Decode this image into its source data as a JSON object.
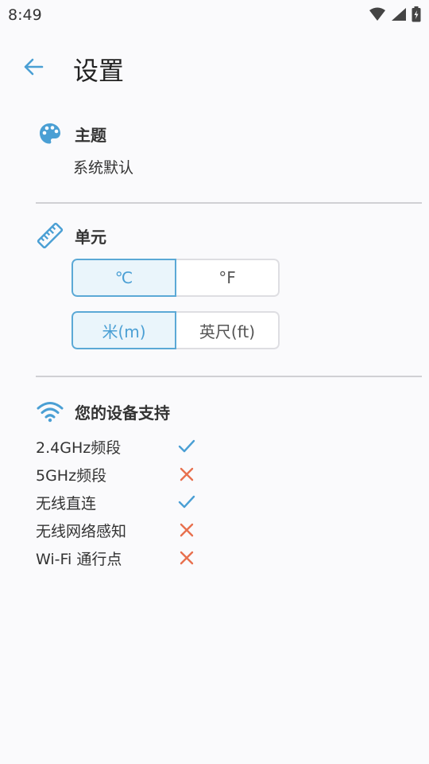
{
  "status_bar": {
    "time": "8:49"
  },
  "header": {
    "title": "设置",
    "back_icon": "arrow-left-icon"
  },
  "theme": {
    "title": "主题",
    "value": "系统默认",
    "icon": "palette-icon"
  },
  "units": {
    "title": "单元",
    "icon": "ruler-icon",
    "temperature": {
      "options": [
        "℃",
        "°F"
      ],
      "selected": "℃"
    },
    "length": {
      "options": [
        "米(m)",
        "英尺(ft)"
      ],
      "selected": "米(m)"
    }
  },
  "support": {
    "title": "您的设备支持",
    "icon": "wifi-icon",
    "items": [
      {
        "label": "2.4GHz频段",
        "supported": true
      },
      {
        "label": "5GHz频段",
        "supported": false
      },
      {
        "label": "无线直连",
        "supported": true
      },
      {
        "label": "无线网络感知",
        "supported": false
      },
      {
        "label": "Wi-Fi 通行点",
        "supported": false
      }
    ]
  },
  "colors": {
    "accent": "#4a9fd4",
    "check": "#4a9fd4",
    "cross": "#e8704e"
  }
}
